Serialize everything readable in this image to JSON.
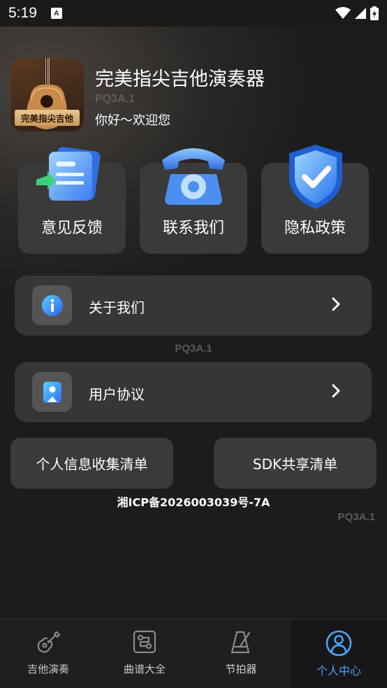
{
  "status": {
    "time": "5:19",
    "notif_letter": "A"
  },
  "app": {
    "icon_label": "完美指尖吉他",
    "title": "完美指尖吉他演奏器",
    "version": "PQ3A.1",
    "greeting": "你好～欢迎您"
  },
  "quick_actions": [
    {
      "label": "意见反馈",
      "icon": "feedback-icon"
    },
    {
      "label": "联系我们",
      "icon": "telephone-icon"
    },
    {
      "label": "隐私政策",
      "icon": "shield-check-icon"
    }
  ],
  "list": {
    "about": {
      "label": "关于我们",
      "icon": "info-icon"
    },
    "about_version": "PQ3A.1",
    "agreement": {
      "label": "用户协议",
      "icon": "bookmark-icon"
    }
  },
  "buttons": {
    "personal_info": "个人信息收集清单",
    "sdk_share": "SDK共享清单"
  },
  "icp": "湘ICP备2026003039号-7A",
  "footer_version": "PQ3A.1",
  "tabs": [
    {
      "label": "吉他演奏",
      "icon": "guitar-icon",
      "active": false
    },
    {
      "label": "曲谱大全",
      "icon": "sheet-music-icon",
      "active": false
    },
    {
      "label": "节拍器",
      "icon": "metronome-icon",
      "active": false
    },
    {
      "label": "个人中心",
      "icon": "user-icon",
      "active": true
    }
  ],
  "colors": {
    "accent": "#48a7ff",
    "card": "#3a3a3a",
    "background": "#1c1c1c"
  }
}
